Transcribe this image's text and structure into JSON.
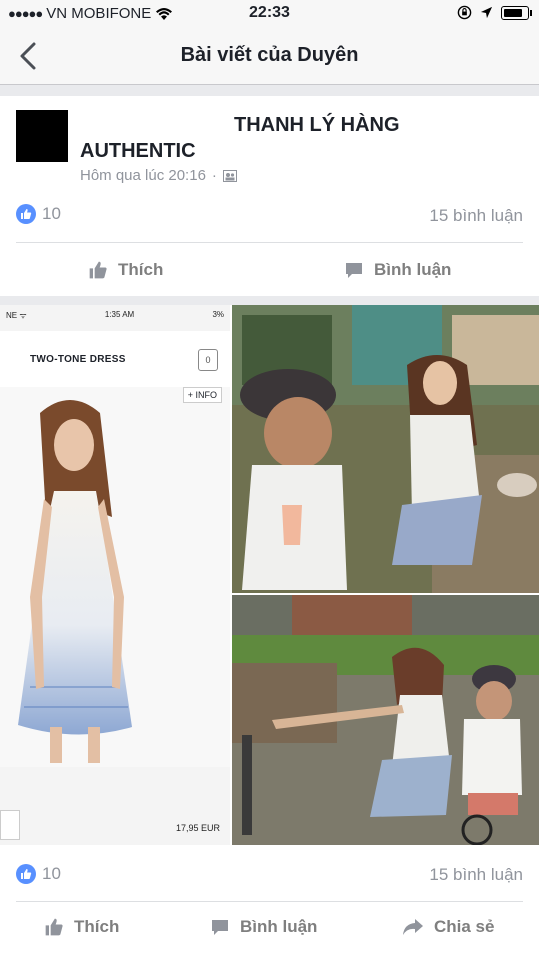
{
  "status_bar": {
    "carrier": "VN MOBIFONE",
    "time": "22:33"
  },
  "nav": {
    "title": "Bài viết của Duyên"
  },
  "post": {
    "title_line1": "THANH LÝ HÀNG",
    "title_line2": "AUTHENTIC",
    "timestamp": "Hôm qua lúc 20:16",
    "likes": "10",
    "comments": "15 bình luận",
    "like_label": "Thích",
    "comment_label": "Bình luận"
  },
  "photo_left": {
    "time": "1:35 AM",
    "battery": "3%",
    "product_name": "TWO-TONE DRESS",
    "cart_count": "0",
    "info_label": "+ INFO",
    "price": "17,95 EUR"
  },
  "photo_post": {
    "likes": "10",
    "comments": "15 bình luận",
    "like_label": "Thích",
    "comment_label": "Bình luận",
    "share_label": "Chia sẻ"
  },
  "colors": {
    "like_blue": "#5890ff",
    "muted_gray": "#90949c",
    "page_bg": "#e9eaed"
  }
}
